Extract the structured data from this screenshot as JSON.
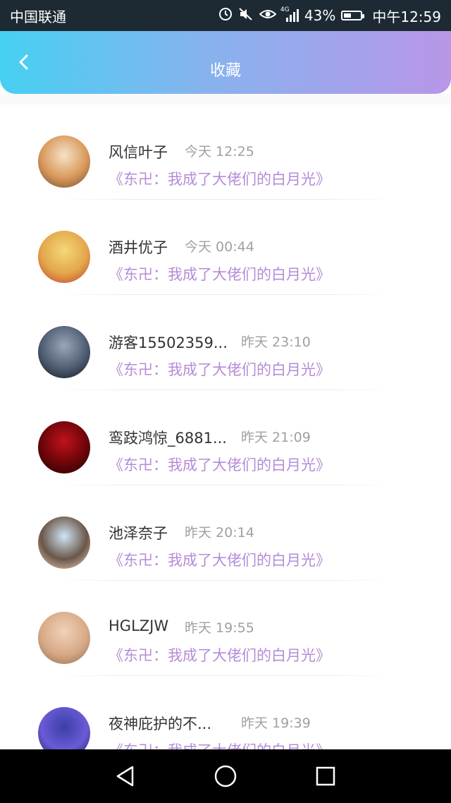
{
  "status_bar": {
    "carrier": "中国联通",
    "network": "4G",
    "battery": "43%",
    "time": "中午12:59"
  },
  "header": {
    "title": "收藏"
  },
  "favorites": [
    {
      "name": "风信叶子",
      "time": "今天 12:25",
      "book": "《东卍：我成了大佬们的白月光》",
      "avatar_colors": [
        "#f5e3c8",
        "#d9985a",
        "#6b4a30"
      ]
    },
    {
      "name": "酒井优子",
      "time": "今天 00:44",
      "book": "《东卍：我成了大佬们的白月光》",
      "avatar_colors": [
        "#f6d77a",
        "#e3a64b",
        "#c0392b"
      ]
    },
    {
      "name": "游客15502359...",
      "time": "昨天 23:10",
      "book": "《东卍：我成了大佬们的白月光》",
      "avatar_colors": [
        "#9aa6b8",
        "#4f5d73",
        "#0f1418"
      ]
    },
    {
      "name": "鸾跂鸿惊_6881...",
      "time": "昨天 21:09",
      "book": "《东卍：我成了大佬们的白月光》",
      "avatar_colors": [
        "#c0121d",
        "#6b0508",
        "#1a0202"
      ]
    },
    {
      "name": "池泽奈子",
      "time": "昨天 20:14",
      "book": "《东卍：我成了大佬们的白月光》",
      "avatar_colors": [
        "#cfe6f5",
        "#6a5648",
        "#f3d7c4"
      ]
    },
    {
      "name": "HGLZJW",
      "time": "昨天 19:55",
      "book": "《东卍：我成了大佬们的白月光》",
      "avatar_colors": [
        "#f0d2b8",
        "#d8aa86",
        "#8c6a52"
      ]
    },
    {
      "name": "夜神庇护的不...",
      "time": "昨天 19:39",
      "book": "《东卍：我成了大佬们的白月光》",
      "avatar_colors": [
        "#3b3fa8",
        "#6a5bd6",
        "#151a5a"
      ]
    }
  ]
}
